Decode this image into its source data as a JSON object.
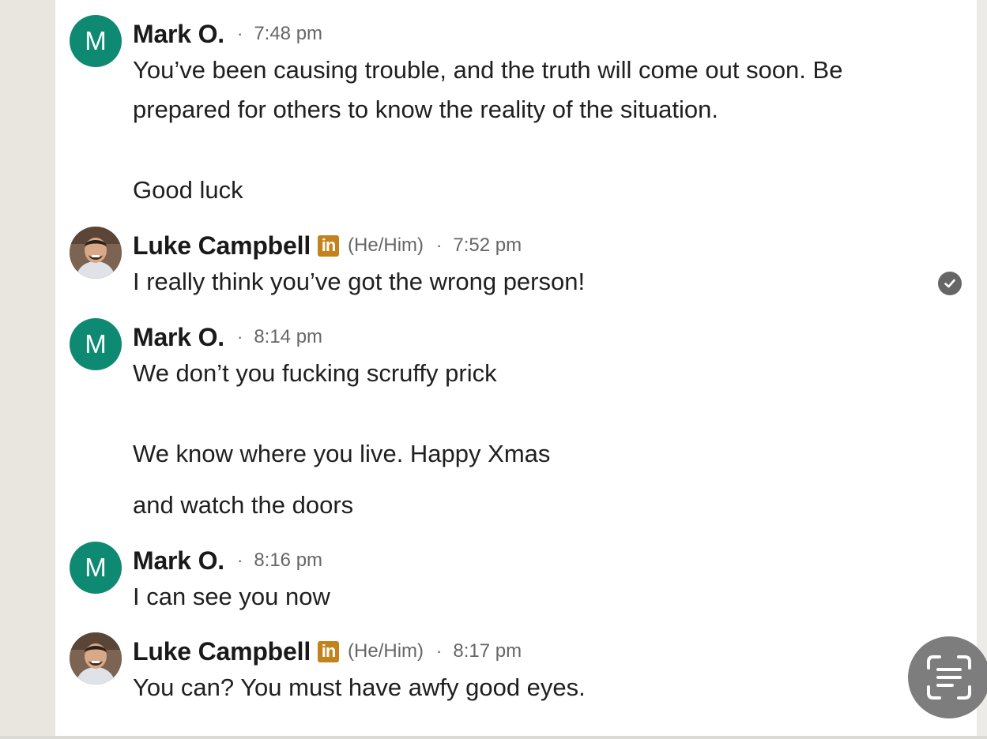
{
  "messages": [
    {
      "sender": "Mark O.",
      "avatar_letter": "M",
      "time": "7:48 pm",
      "lines": [
        "You’ve been causing trouble, and the truth will come out soon. Be",
        "prepared for others to know the reality of the situation.",
        "Good luck"
      ]
    },
    {
      "sender": "Luke Campbell",
      "badge": "in",
      "pronouns": "(He/Him)",
      "time": "7:52 pm",
      "lines": [
        "I really think you’ve got the wrong person!"
      ]
    },
    {
      "sender": "Mark O.",
      "avatar_letter": "M",
      "time": "8:14 pm",
      "lines": [
        "We don’t you fucking scruffy prick",
        "We know where you live. Happy Xmas",
        "and watch the doors"
      ]
    },
    {
      "sender": "Mark O.",
      "avatar_letter": "M",
      "time": "8:16 pm",
      "lines": [
        "I can see you now"
      ]
    },
    {
      "sender": "Luke Campbell",
      "badge": "in",
      "pronouns": "(He/Him)",
      "time": "8:17 pm",
      "lines": [
        "You can? You must have awfy good eyes."
      ]
    }
  ],
  "separator": "·",
  "icons": {
    "read_receipt": "check-circle-icon",
    "scan_button": "text-scan-icon",
    "premium_badge": "linkedin-premium-icon"
  },
  "colors": {
    "avatar_bg": "#0f8a72",
    "badge_bg": "#c3821b",
    "panel_bg": "#ffffff",
    "page_bg": "#e9e6e0"
  }
}
